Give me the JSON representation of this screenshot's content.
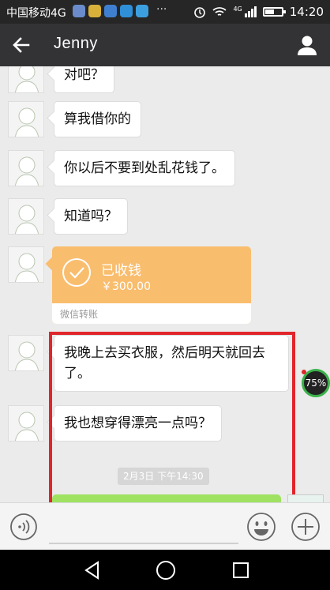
{
  "status_bar": {
    "carrier": "中国移动4G",
    "dots": "···",
    "network": "4G",
    "time": "14:20",
    "battery_level": 0.55
  },
  "header": {
    "title": "Jenny"
  },
  "messages": [
    {
      "text": "对吧？"
    },
    {
      "text": "算我借你的"
    },
    {
      "text": "你以后不要到处乱花钱了。"
    },
    {
      "text": "知道吗？"
    }
  ],
  "transfer": {
    "status": "已收钱",
    "amount": "￥300.00",
    "footer": "微信转账"
  },
  "highlighted_messages": [
    {
      "line1": "我晚上去买衣服，然后明天就回去",
      "line2": "了。"
    },
    {
      "text": "我也想穿得漂亮一点吗？"
    }
  ],
  "speed_badge": "75%",
  "timestamp": "2月3日 下午14:30",
  "colors": {
    "highlight": "#e0262b",
    "transfer": "#f9bd6e",
    "self_bubble": "#9fe262"
  }
}
